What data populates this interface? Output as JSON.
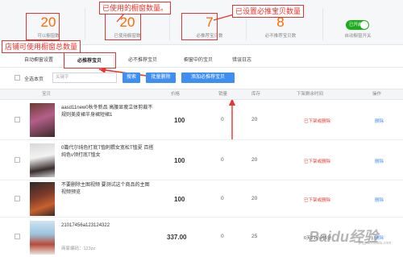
{
  "stats": [
    {
      "value": "20",
      "label": "可以橱窗数"
    },
    {
      "value": "20",
      "label": "已使用橱窗数"
    },
    {
      "value": "7",
      "label": "必推荐宝贝数"
    },
    {
      "value": "8",
      "label": "必不推荐宝贝数"
    }
  ],
  "toggle": {
    "text": "已开启",
    "label": "自动橱窗开关",
    "state": "on",
    "color": "#1aad19"
  },
  "annotations": {
    "used": "已使用的橱窗数量。",
    "must_recommend": "已设置必推宝贝数量",
    "total": "店铺可使用橱窗总数量"
  },
  "tabs": [
    "自动橱窗设置",
    "必推荐宝贝",
    "必不推荐宝贝",
    "橱窗中的宝贝",
    "错误日志"
  ],
  "active_tab": 1,
  "toolbar": {
    "select_page": "全选本页",
    "search_placeholder": "关键字",
    "search": "搜索",
    "batch_delete": "批量删除",
    "add": "添加必推荐宝贝"
  },
  "columns": [
    "宝贝",
    "价格",
    "销量",
    "库存",
    "下架剩余时间",
    "操作"
  ],
  "rows": [
    {
      "name": "aasd11new0秋冬新品 高腰显瘦立体剪裁不规则美皮裙半身裙短裙1",
      "price": "100",
      "sales": "0",
      "stock": "20",
      "remaining": "已下架或删除",
      "action": "删除"
    },
    {
      "name": "0篇代尔纯色打底T恤刺猬女宽松T恤夏 百搭纯色v领打底T恤女",
      "price": "100",
      "sales": "0",
      "stock": "20",
      "remaining": "已下架或删除",
      "action": "删除"
    },
    {
      "name": "不要删除主图视频 要测试这个商品的主图视频预览",
      "price": "100",
      "sales": "0",
      "stock": "20",
      "remaining": "已下架或删除",
      "action": "删除"
    },
    {
      "name": "21017456a123124322",
      "sub": "商家编码：123zz",
      "price": "337.00",
      "sales": "0",
      "stock": "25",
      "remaining": "6天21小时5分",
      "action": "删除"
    }
  ],
  "colors": {
    "accent": "#ff6a00",
    "button": "#3f8ff0",
    "annotation": "#e8332e",
    "warning": "#e53935"
  },
  "watermark": "Baidu经验",
  "watermark_sub": "jingyan.baidu.com"
}
